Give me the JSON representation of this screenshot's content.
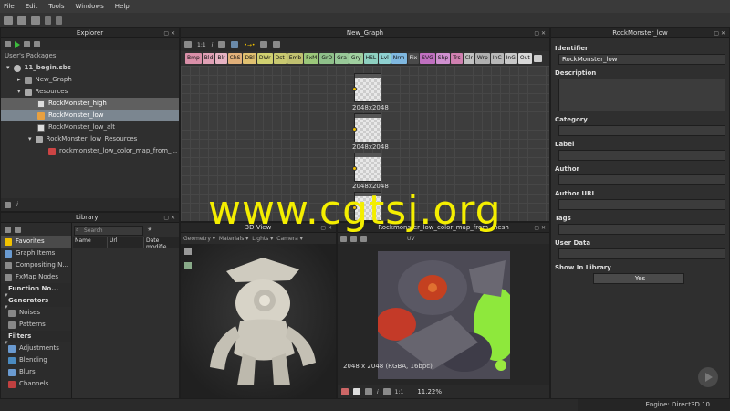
{
  "menu": [
    "File",
    "Edit",
    "Tools",
    "Windows",
    "Help"
  ],
  "explorer": {
    "title": "Explorer",
    "section": "User's Packages",
    "items": [
      {
        "label": "11_begin.sbs",
        "indent": 0
      },
      {
        "label": "New_Graph",
        "indent": 1
      },
      {
        "label": "Resources",
        "indent": 1
      },
      {
        "label": "RockMonster_high",
        "indent": 2
      },
      {
        "label": "RockMonster_low",
        "indent": 2
      },
      {
        "label": "RockMonster_low_alt",
        "indent": 2
      },
      {
        "label": "RockMonster_low_Resources",
        "indent": 2
      },
      {
        "label": "rockmonster_low_color_map_from_...",
        "indent": 3
      }
    ]
  },
  "graph": {
    "title": "New_Graph",
    "zoom": "1:1",
    "chips": [
      {
        "label": "Bmp",
        "color": "#d98fa8"
      },
      {
        "label": "Bld",
        "color": "#e0a0b5"
      },
      {
        "label": "Blr",
        "color": "#e6b2c2"
      },
      {
        "label": "ChS",
        "color": "#e1b07a"
      },
      {
        "label": "DBl",
        "color": "#e0c070"
      },
      {
        "label": "DWr",
        "color": "#d0d070"
      },
      {
        "label": "Dst",
        "color": "#c8c870"
      },
      {
        "label": "Emb",
        "color": "#c0c070"
      },
      {
        "label": "FxM",
        "color": "#9bc77a"
      },
      {
        "label": "GrD",
        "color": "#8fc08a"
      },
      {
        "label": "Gra",
        "color": "#98c898"
      },
      {
        "label": "Gry",
        "color": "#a0d0a0"
      },
      {
        "label": "HSL",
        "color": "#8ed0c0"
      },
      {
        "label": "Lvl",
        "color": "#8ed0d0"
      },
      {
        "label": "Nrm",
        "color": "#7fb8e0"
      },
      {
        "label": "Pix",
        "color": "#4a4a4a"
      },
      {
        "label": "SVG",
        "color": "#c070c0"
      },
      {
        "label": "Shp",
        "color": "#d090d0"
      },
      {
        "label": "Trs",
        "color": "#d080b0"
      },
      {
        "label": "Clr",
        "color": "#c0c0c0"
      },
      {
        "label": "Wrp",
        "color": "#b0b0b0"
      },
      {
        "label": "InC",
        "color": "#b8b8b8"
      },
      {
        "label": "InG",
        "color": "#c8c8c8"
      },
      {
        "label": "Out",
        "color": "#d8d8d8"
      }
    ],
    "nodes": [
      {
        "label": "2048x2048"
      },
      {
        "label": "2048x2048"
      },
      {
        "label": "2048x2048"
      },
      {
        "label": "2048x2048"
      }
    ]
  },
  "library": {
    "title": "Library",
    "search_placeholder": "Search",
    "columns": [
      "Name",
      "Url",
      "Date modifie"
    ],
    "categories": [
      {
        "label": "Favorites",
        "kind": "fav"
      },
      {
        "label": "Graph Items",
        "kind": "item"
      },
      {
        "label": "Compositing N...",
        "kind": "item"
      },
      {
        "label": "FxMap Nodes",
        "kind": "item"
      },
      {
        "label": "Function No...",
        "kind": "hdr"
      },
      {
        "label": "Generators",
        "kind": "hdr"
      },
      {
        "label": "Noises",
        "kind": "sub"
      },
      {
        "label": "Patterns",
        "kind": "sub"
      },
      {
        "label": "Filters",
        "kind": "hdr"
      },
      {
        "label": "Adjustments",
        "kind": "sub"
      },
      {
        "label": "Blending",
        "kind": "sub"
      },
      {
        "label": "Blurs",
        "kind": "sub"
      },
      {
        "label": "Channels",
        "kind": "sub"
      }
    ]
  },
  "view3d": {
    "title": "3D View",
    "menus": [
      "Geometry ▾",
      "Materials ▾",
      "Lights ▾",
      "Camera ▾"
    ]
  },
  "view2d": {
    "title": "Rockmonster_low_color_map_from_mesh",
    "toolbar_label": "UV",
    "info": "2048 x 2048 (RGBA, 16bpc)",
    "zoom_ratio": "1:1",
    "zoom": "11.22%"
  },
  "properties": {
    "title": "RockMonster_low",
    "fields": [
      {
        "label": "Identifier",
        "value": "RockMonster_low"
      },
      {
        "label": "Description",
        "value": ""
      },
      {
        "label": "Category",
        "value": ""
      },
      {
        "label": "Label",
        "value": ""
      },
      {
        "label": "Author",
        "value": ""
      },
      {
        "label": "Author URL",
        "value": ""
      },
      {
        "label": "Tags",
        "value": ""
      },
      {
        "label": "User Data",
        "value": ""
      }
    ],
    "show_in_library_label": "Show In Library",
    "show_in_library_value": "Yes"
  },
  "watermark": "www.cgtsj.org",
  "status": "Engine: Direct3D 10"
}
